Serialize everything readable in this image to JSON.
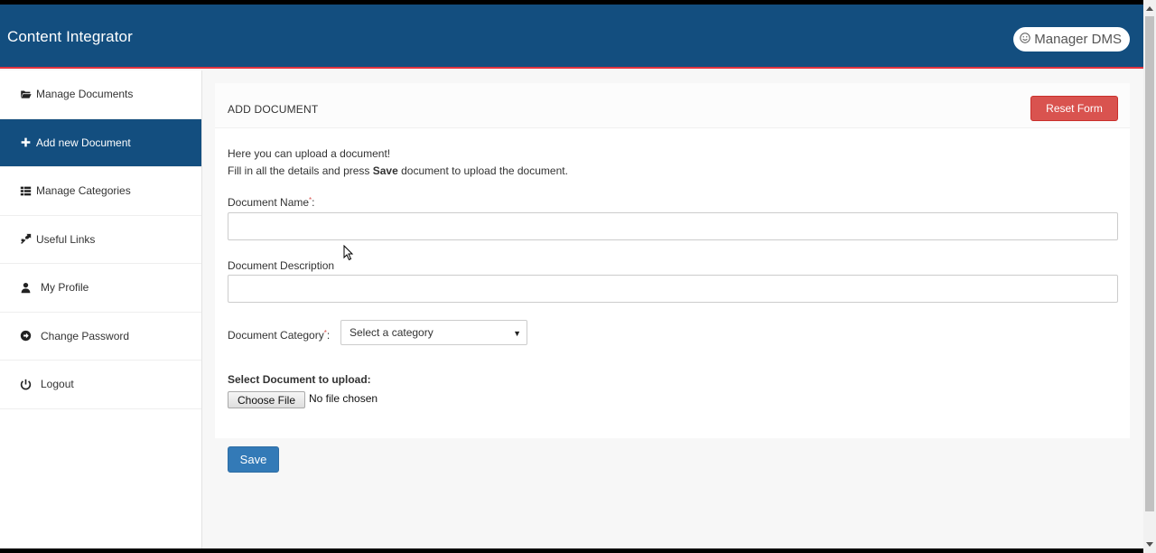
{
  "header": {
    "app_title": "Content Integrator",
    "user_label": "Manager DMS",
    "user_icon": "smile-icon",
    "accent_color": "#134e7f",
    "border_color": "#e2343f"
  },
  "sidebar": {
    "items": [
      {
        "label": "Manage Documents",
        "icon": "folder-open-icon",
        "active": false
      },
      {
        "label": "Add new Document",
        "icon": "plus-icon",
        "active": true
      },
      {
        "label": "Manage Categories",
        "icon": "list-icon",
        "active": false
      },
      {
        "label": "Useful Links",
        "icon": "compress-icon",
        "active": false
      },
      {
        "label": "My Profile",
        "icon": "user-icon",
        "active": false
      },
      {
        "label": "Change Password",
        "icon": "arrow-circle-icon",
        "active": false
      },
      {
        "label": "Logout",
        "icon": "power-icon",
        "active": false
      }
    ]
  },
  "form": {
    "panel_title": "ADD DOCUMENT",
    "reset_label": "Reset Form",
    "intro_line1": "Here you can upload a document!",
    "intro_line2_pre": "Fill in all the details and press ",
    "intro_line2_bold": "Save",
    "intro_line2_post": " document to upload the document.",
    "name_label": "Document Name",
    "name_value": "",
    "description_label": "Document Description",
    "description_value": "",
    "category_label": "Document Category",
    "category_selected": "Select a category",
    "required_mark": "*",
    "colon": ":",
    "upload_label": "Select Document to upload:",
    "choose_file_label": "Choose File",
    "file_status": "No file chosen",
    "save_label": "Save"
  }
}
